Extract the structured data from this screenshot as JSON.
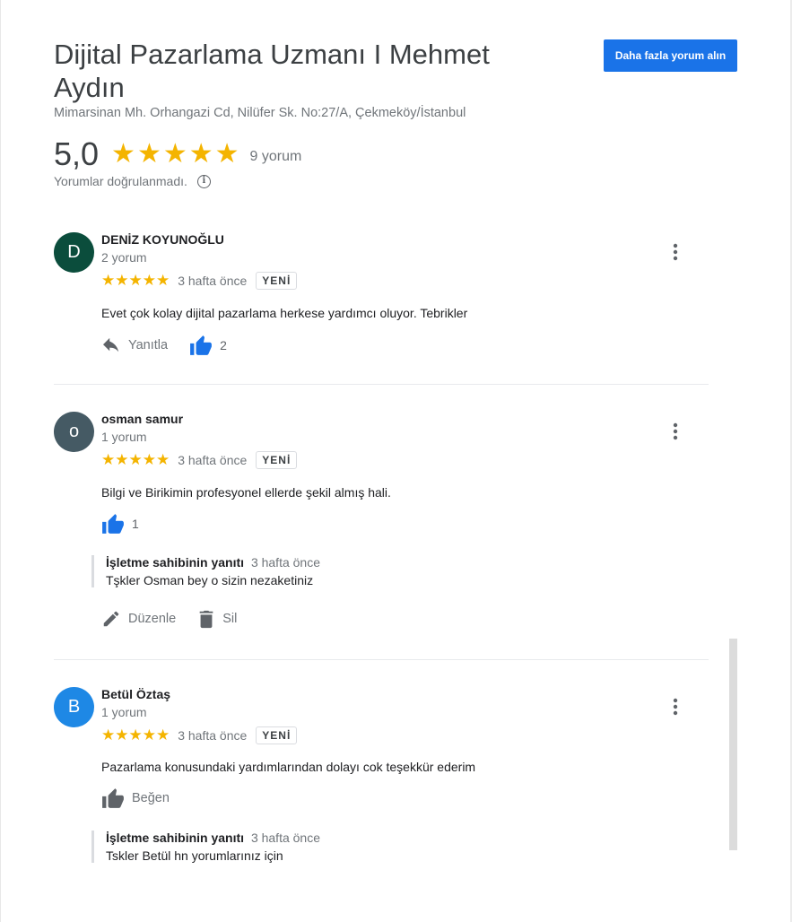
{
  "header": {
    "title": "Dijital Pazarlama Uzmanı I Mehmet Aydın",
    "address": "Mimarsinan Mh. Orhangazi Cd, Nilüfer Sk. No:27/A, Çekmeköy/İstanbul",
    "more_reviews_button": "Daha fazla yorum alın",
    "rating": "5,0",
    "stars": "★★★★★",
    "review_count": "9 yorum",
    "verify_note": "Yorumlar doğrulanmadı."
  },
  "reviews": [
    {
      "avatar_letter": "D",
      "avatar_color": "#0b4d3c",
      "name": "DENİZ KOYUNOĞLU",
      "review_count": "2 yorum",
      "stars": "★★★★★",
      "date": "3 hafta önce",
      "badge": "YENİ",
      "text": "Evet çok kolay dijital pazarlama herkese yardımcı oluyor. Tebrikler",
      "reply_label": "Yanıtla",
      "likes": "2"
    },
    {
      "avatar_letter": "o",
      "avatar_color": "#455a64",
      "name": "osman samur",
      "review_count": "1 yorum",
      "stars": "★★★★★",
      "date": "3 hafta önce",
      "badge": "YENİ",
      "text": "Bilgi ve Birikimin profesyonel ellerde şekil almış hali.",
      "likes": "1",
      "owner_reply": {
        "title": "İşletme sahibinin yanıtı",
        "date": "3 hafta önce",
        "text": "Tşkler Osman bey o sizin nezaketiniz"
      },
      "edit_label": "Düzenle",
      "delete_label": "Sil"
    },
    {
      "avatar_letter": "B",
      "avatar_color": "#1e88e5",
      "name": "Betül Öztaş",
      "review_count": "1 yorum",
      "stars": "★★★★★",
      "date": "3 hafta önce",
      "badge": "YENİ",
      "text": "Pazarlama konusundaki yardımlarından dolayı cok teşekkür ederim",
      "like_label": "Beğen",
      "owner_reply": {
        "title": "İşletme sahibinin yanıtı",
        "date": "3 hafta önce",
        "text": "Tskler Betül hn yorumlarınız için"
      }
    }
  ],
  "icons": {
    "info": "info-icon",
    "kebab": "more-vert-icon",
    "reply": "reply-icon",
    "like": "thumb-up-icon",
    "edit": "pencil-icon",
    "delete": "trash-icon"
  },
  "colors": {
    "accent": "#1a73e8",
    "star": "#f4b400",
    "like_active": "#1a73e8"
  }
}
